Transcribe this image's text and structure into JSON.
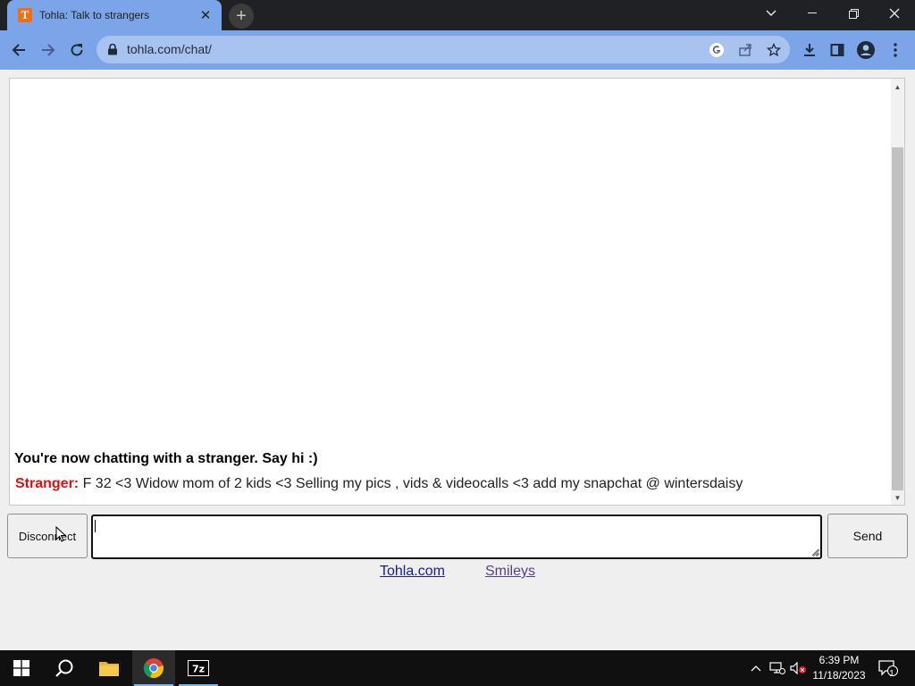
{
  "browser": {
    "tab_title": "Tohla: Talk to strangers",
    "tab_favicon_letter": "T",
    "url": "tohla.com/chat/",
    "icons": [
      "back-icon",
      "forward-icon",
      "reload-icon",
      "lock-icon",
      "google-icon",
      "share-icon",
      "star-icon",
      "download-icon",
      "side-panel-icon",
      "profile-icon",
      "menu-icon"
    ]
  },
  "chat": {
    "system_message": "You're now chatting with a stranger. Say hi :)",
    "stranger_label": "Stranger:",
    "stranger_message": " F 32 <3 Widow mom of 2 kids <3 Selling my pics , vids & videocalls <3 add my snapchat @ wintersdaisy",
    "input_value": ""
  },
  "controls": {
    "disconnect_label": "Disconnect",
    "send_label": "Send"
  },
  "footer_links": {
    "home": "Tohla.com",
    "smileys": "Smileys"
  },
  "taskbar": {
    "time": "6:39 PM",
    "date": "11/18/2023",
    "notification_count": "1",
    "apps": [
      "windows-start",
      "search",
      "file-explorer",
      "chrome",
      "7zip"
    ]
  },
  "colors": {
    "tab_active": "#7ca4e8",
    "stranger_label": "#e01010",
    "link": "#1a1aa6",
    "visited_link": "#5a3d8a"
  }
}
